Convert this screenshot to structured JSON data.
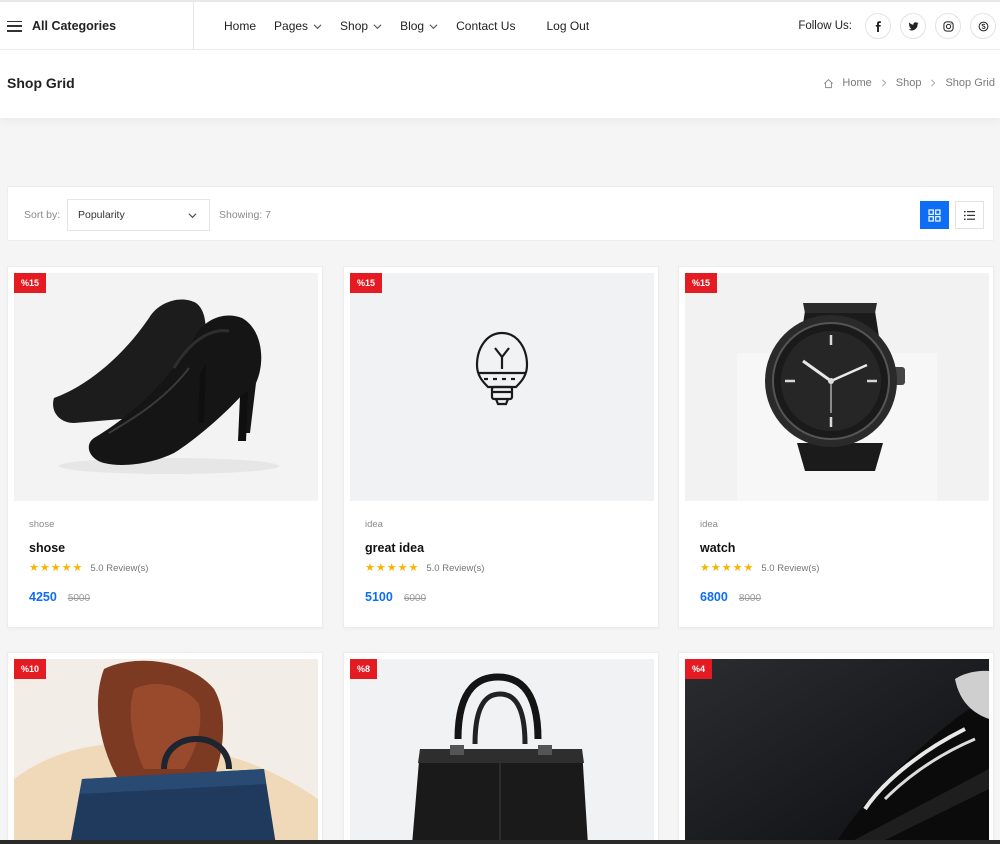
{
  "nav": {
    "categories_label": "All Categories",
    "menu": [
      {
        "label": "Home",
        "dropdown": false
      },
      {
        "label": "Pages",
        "dropdown": true
      },
      {
        "label": "Shop",
        "dropdown": true
      },
      {
        "label": "Blog",
        "dropdown": true
      },
      {
        "label": "Contact Us",
        "dropdown": false
      },
      {
        "label": "Log Out",
        "dropdown": false
      }
    ],
    "follow_label": "Follow Us:",
    "social": [
      "facebook-icon",
      "twitter-icon",
      "instagram-icon",
      "skype-icon"
    ]
  },
  "page_header": {
    "title": "Shop Grid",
    "breadcrumb": [
      "Home",
      "Shop",
      "Shop Grid"
    ]
  },
  "toolbar": {
    "sort_label": "Sort by:",
    "sort_value": "Popularity",
    "showing": "Showing: 7",
    "view_mode": "grid"
  },
  "colors": {
    "accent": "#0d6ef5",
    "badge": "#e41b23",
    "star": "#f7b500"
  },
  "products": [
    {
      "badge": "%15",
      "category": "shose",
      "title": "shose",
      "reviews": "5.0 Review(s)",
      "price": "4250",
      "old_price": "5000",
      "image": "black-high-heel-shoe"
    },
    {
      "badge": "%15",
      "category": "idea",
      "title": "great idea",
      "reviews": "5.0 Review(s)",
      "price": "5100",
      "old_price": "6000",
      "image": "lightbulb-outline"
    },
    {
      "badge": "%15",
      "category": "idea",
      "title": "watch",
      "reviews": "5.0 Review(s)",
      "price": "6800",
      "old_price": "8000",
      "image": "black-wristwatch"
    },
    {
      "badge": "%10",
      "category": "",
      "title": "",
      "reviews": "",
      "price": "",
      "old_price": "",
      "image": "woman-with-blue-handbag"
    },
    {
      "badge": "%8",
      "category": "",
      "title": "",
      "reviews": "",
      "price": "",
      "old_price": "",
      "image": "black-leather-handbag"
    },
    {
      "badge": "%4",
      "category": "",
      "title": "",
      "reviews": "",
      "price": "",
      "old_price": "",
      "image": "black-sneaker"
    }
  ]
}
